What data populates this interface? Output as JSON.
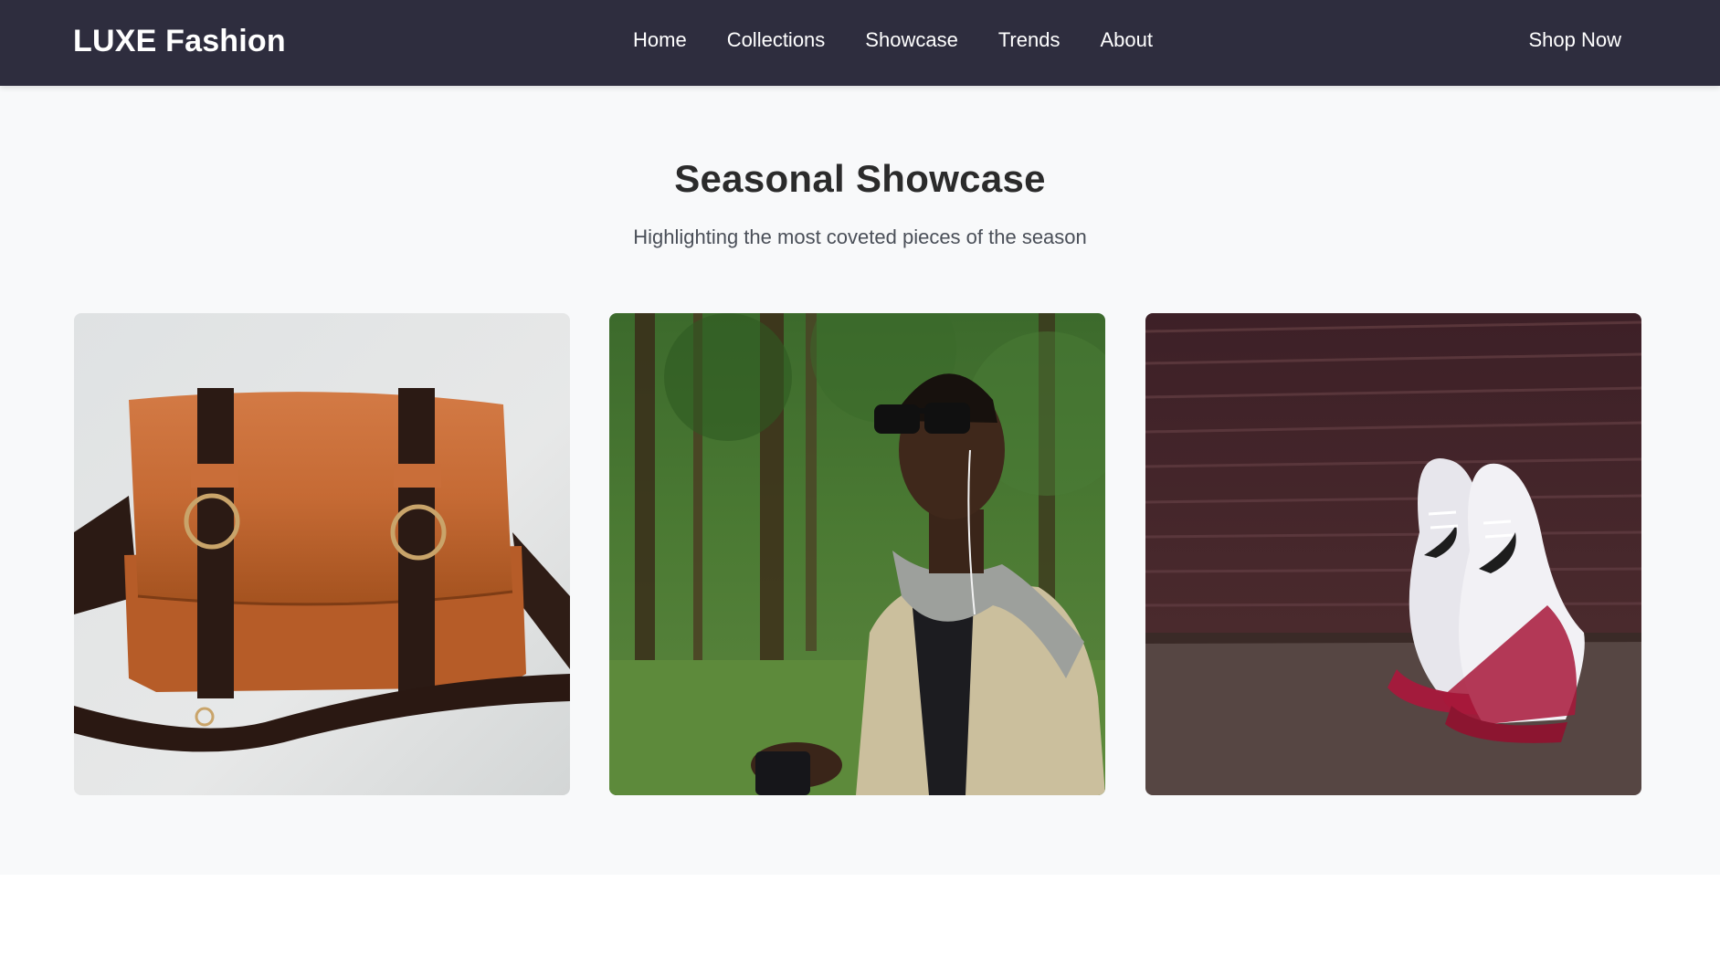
{
  "navbar": {
    "logo": "LUXE Fashion",
    "links": [
      "Home",
      "Collections",
      "Showcase",
      "Trends",
      "About"
    ],
    "cta": "Shop Now"
  },
  "showcase": {
    "title": "Seasonal Showcase",
    "subtitle": "Highlighting the most coveted pieces of the season"
  },
  "colors": {
    "nav_bg": "#2e2d3e",
    "section_bg": "#f8f9fa",
    "title": "#2b2b2b",
    "subtitle": "#4a4f58"
  }
}
